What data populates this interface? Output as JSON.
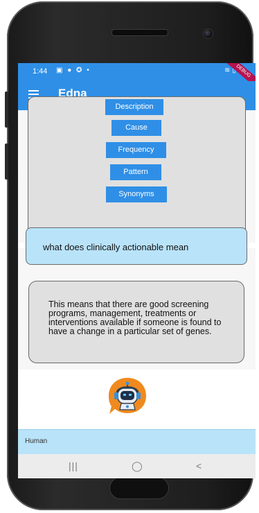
{
  "status_bar": {
    "time": "1:44",
    "left_icons": "▣ ● ✪ •",
    "right_icons": "≋ ▯ ▮",
    "debug_label": "debug"
  },
  "app_bar": {
    "title": "Edna",
    "menu_icon": "hamburger-menu-icon"
  },
  "topic_buttons": [
    {
      "label": "Description"
    },
    {
      "label": "Cause"
    },
    {
      "label": "Frequency"
    },
    {
      "label": "Pattern"
    },
    {
      "label": "Synonyms"
    }
  ],
  "chat": {
    "user_message": "what does clinically actionable mean",
    "bot_answer": "This means that there are good screening programs, management, treatments or interventions available if someone is found to have a change in a particular set of genes.",
    "bot_avatar_icon": "robot-headset-icon"
  },
  "input": {
    "label": "Human"
  },
  "nav_bar": {
    "recents_icon": "|||",
    "home_icon": "◯",
    "back_icon": "<"
  },
  "colors": {
    "primary": "#2f8fe6",
    "user_bubble": "#b9e3f9",
    "bot_bubble": "#e0e0e0",
    "robot_orange": "#f08a1f"
  }
}
